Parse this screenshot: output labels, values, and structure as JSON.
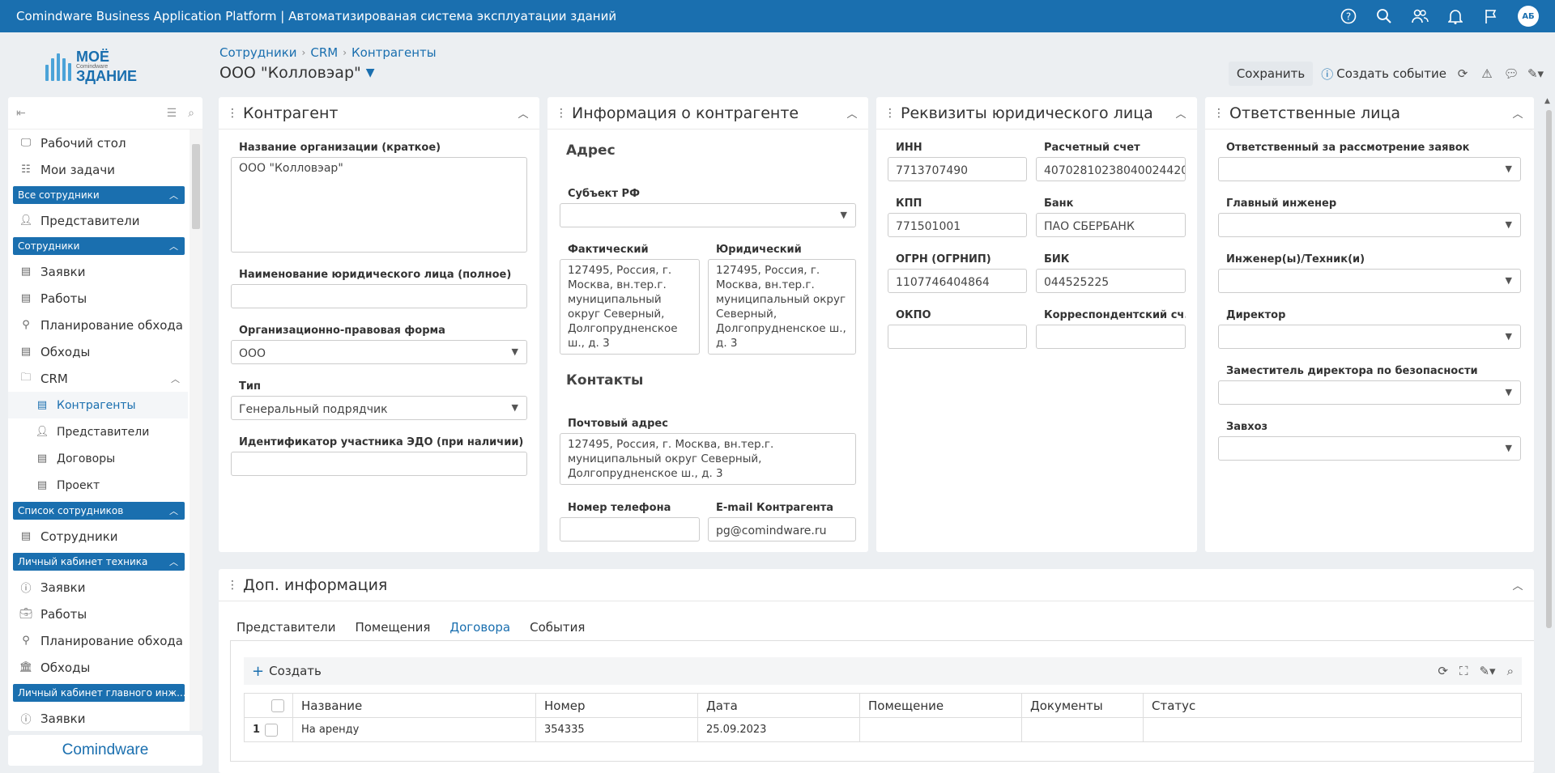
{
  "app": {
    "title": "Comindware Business Application Platform | Автоматизированая система эксплуатации зданий",
    "user_initials": "АБ",
    "top_icons": [
      "help-icon",
      "search-icon",
      "users-icon",
      "bell-icon",
      "flag-icon"
    ]
  },
  "logo": {
    "line1": "МОЁ",
    "line2": "ЗДАНИЕ",
    "brand": "Comindware"
  },
  "breadcrumb": [
    "Сотрудники",
    "CRM",
    "Контрагенты"
  ],
  "page_title": "ООО \"Колловэар\"",
  "actions": {
    "save": "Сохранить",
    "create_event": "Создать событие"
  },
  "sidebar": {
    "items": [
      {
        "type": "item",
        "label": "Рабочий стол",
        "icon": "desktop-icon"
      },
      {
        "type": "item",
        "label": "Мои задачи",
        "icon": "tasks-icon"
      },
      {
        "type": "group",
        "label": "Все сотрудники"
      },
      {
        "type": "item",
        "label": "Представители",
        "icon": "person-icon"
      },
      {
        "type": "group",
        "label": "Сотрудники"
      },
      {
        "type": "item",
        "label": "Заявки",
        "icon": "list-icon"
      },
      {
        "type": "item",
        "label": "Работы",
        "icon": "list-icon"
      },
      {
        "type": "item",
        "label": "Планирование обхода",
        "icon": "route-icon"
      },
      {
        "type": "item",
        "label": "Обходы",
        "icon": "list-icon"
      },
      {
        "type": "item",
        "label": "CRM",
        "icon": "folder-icon",
        "expanded": true
      },
      {
        "type": "sub",
        "label": "Контрагенты",
        "icon": "list-icon",
        "active": true
      },
      {
        "type": "sub",
        "label": "Представители",
        "icon": "person-icon"
      },
      {
        "type": "sub",
        "label": "Договоры",
        "icon": "list-icon"
      },
      {
        "type": "sub",
        "label": "Проект",
        "icon": "list-icon"
      },
      {
        "type": "group",
        "label": "Список сотрудников"
      },
      {
        "type": "item",
        "label": "Сотрудники",
        "icon": "list-icon"
      },
      {
        "type": "group",
        "label": "Личный кабинет техника"
      },
      {
        "type": "item",
        "label": "Заявки",
        "icon": "info-icon"
      },
      {
        "type": "item",
        "label": "Работы",
        "icon": "briefcase-icon"
      },
      {
        "type": "item",
        "label": "Планирование обхода",
        "icon": "route-icon"
      },
      {
        "type": "item",
        "label": "Обходы",
        "icon": "building-icon"
      },
      {
        "type": "group",
        "label": "Личный кабинет главного инж..."
      },
      {
        "type": "item",
        "label": "Заявки",
        "icon": "info-icon"
      }
    ],
    "footer": "Comindware"
  },
  "panel_counterparty": {
    "title": "Контрагент",
    "short_name_label": "Название организации (краткое)",
    "short_name_value": "ООО \"Колловэар\"",
    "full_name_label": "Наименование юридического лица (полное)",
    "full_name_value": "",
    "form_label": "Организационно-правовая форма",
    "form_value": "ООО",
    "type_label": "Тип",
    "type_value": "Генеральный подрядчик",
    "edo_label": "Идентификатор участника ЭДО (при наличии)",
    "edo_value": ""
  },
  "panel_info": {
    "title": "Информация о контрагенте",
    "address_section": "Адрес",
    "region_label": "Субъект РФ",
    "region_value": "",
    "actual_label": "Фактический",
    "actual_value": "127495, Россия, г. Москва, вн.тер.г. муниципальный округ Северный, Долгопрудненское ш., д. 3",
    "legal_label": "Юридический",
    "legal_value": "127495, Россия, г. Москва, вн.тер.г. муниципальный округ Северный, Долгопрудненское ш., д. 3",
    "contacts_section": "Контакты",
    "postal_label": "Почтовый адрес",
    "postal_value": "127495, Россия, г. Москва, вн.тер.г. муниципальный округ Северный, Долгопрудненское ш., д. 3",
    "phone_label": "Номер телефона",
    "phone_value": "",
    "email_label": "E-mail Контрагента",
    "email_value": "pg@comindware.ru"
  },
  "panel_requisites": {
    "title": "Реквизиты юридического лица",
    "inn_label": "ИНН",
    "inn_value": "7713707490",
    "account_label": "Расчетный счет",
    "account_value": "40702810238040024420",
    "kpp_label": "КПП",
    "kpp_value": "771501001",
    "bank_label": "Банк",
    "bank_value": "ПАО СБЕРБАНК",
    "ogrn_label": "ОГРН (ОГРНИП)",
    "ogrn_value": "1107746404864",
    "bik_label": "БИК",
    "bik_value": "044525225",
    "okpo_label": "ОКПО",
    "okpo_value": "",
    "corr_label": "Корреспондентский сч...",
    "corr_value": ""
  },
  "panel_responsible": {
    "title": "Ответственные лица",
    "fields": [
      {
        "label": "Ответственный за рассмотрение заявок",
        "value": ""
      },
      {
        "label": "Главный инженер",
        "value": ""
      },
      {
        "label": "Инженер(ы)/Техник(и)",
        "value": ""
      },
      {
        "label": "Директор",
        "value": ""
      },
      {
        "label": "Заместитель директора по безопасности",
        "value": ""
      },
      {
        "label": "Завхоз",
        "value": ""
      }
    ]
  },
  "panel_extra": {
    "title": "Доп. информация",
    "tabs": [
      "Представители",
      "Помещения",
      "Договора",
      "События"
    ],
    "active_tab": "Договора",
    "create_label": "Создать",
    "columns": [
      "Название",
      "Номер",
      "Дата",
      "Помещение",
      "Документы",
      "Статус"
    ],
    "rows": [
      {
        "n": "1",
        "name": "На аренду",
        "number": "354335",
        "date": "25.09.2023",
        "room": "",
        "docs": "",
        "status": ""
      }
    ]
  }
}
